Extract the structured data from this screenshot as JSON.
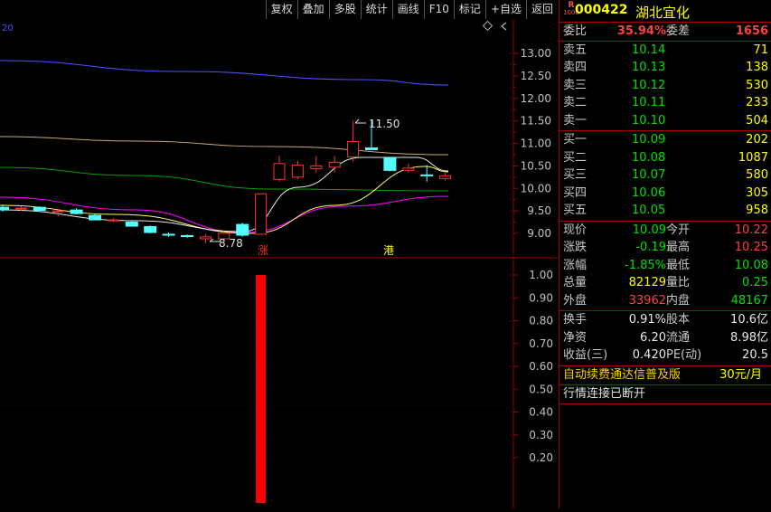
{
  "toolbar": {
    "buttons": [
      "复权",
      "叠加",
      "多股",
      "统计",
      "画线",
      "F10",
      "标记",
      "+自选",
      "返回"
    ]
  },
  "corner_label": "20",
  "chart_data": [
    {
      "type": "candlestick",
      "y_ticks": [
        "13.00",
        "12.50",
        "12.00",
        "11.50",
        "11.00",
        "10.50",
        "10.00",
        "9.50",
        "9.00"
      ],
      "ylim": [
        8.6,
        13.3
      ],
      "candles": [
        {
          "o": 9.58,
          "h": 9.64,
          "l": 9.48,
          "c": 9.52
        },
        {
          "o": 9.55,
          "h": 9.6,
          "l": 9.5,
          "c": 9.56
        },
        {
          "o": 9.58,
          "h": 9.6,
          "l": 9.5,
          "c": 9.51
        },
        {
          "o": 9.48,
          "h": 9.55,
          "l": 9.38,
          "c": 9.5
        },
        {
          "o": 9.52,
          "h": 9.56,
          "l": 9.42,
          "c": 9.44
        },
        {
          "o": 9.4,
          "h": 9.44,
          "l": 9.3,
          "c": 9.3
        },
        {
          "o": 9.3,
          "h": 9.34,
          "l": 9.25,
          "c": 9.3
        },
        {
          "o": 9.25,
          "h": 9.28,
          "l": 9.15,
          "c": 9.16
        },
        {
          "o": 9.15,
          "h": 9.18,
          "l": 9.0,
          "c": 9.02
        },
        {
          "o": 8.98,
          "h": 9.02,
          "l": 8.92,
          "c": 8.96
        },
        {
          "o": 8.95,
          "h": 8.98,
          "l": 8.9,
          "c": 8.94
        },
        {
          "o": 8.88,
          "h": 8.98,
          "l": 8.78,
          "c": 8.92
        },
        {
          "o": 8.88,
          "h": 9.05,
          "l": 8.84,
          "c": 9.0
        },
        {
          "o": 9.2,
          "h": 9.24,
          "l": 8.92,
          "c": 8.96
        },
        {
          "o": 8.98,
          "h": 9.88,
          "l": 8.97,
          "c": 9.88
        },
        {
          "o": 10.2,
          "h": 10.72,
          "l": 10.15,
          "c": 10.55
        },
        {
          "o": 10.25,
          "h": 10.62,
          "l": 10.2,
          "c": 10.52
        },
        {
          "o": 10.44,
          "h": 10.72,
          "l": 10.35,
          "c": 10.5
        },
        {
          "o": 10.47,
          "h": 10.72,
          "l": 10.36,
          "c": 10.58
        },
        {
          "o": 10.7,
          "h": 11.5,
          "l": 10.6,
          "c": 11.04
        },
        {
          "o": 10.9,
          "h": 11.5,
          "l": 10.85,
          "c": 10.86
        },
        {
          "o": 10.68,
          "h": 10.7,
          "l": 10.38,
          "c": 10.4
        },
        {
          "o": 10.4,
          "h": 10.55,
          "l": 10.35,
          "c": 10.45
        },
        {
          "o": 10.3,
          "h": 10.52,
          "l": 10.15,
          "c": 10.28
        },
        {
          "o": 10.22,
          "h": 10.35,
          "l": 10.18,
          "c": 10.28
        }
      ],
      "max_annotation": "11.50",
      "min_annotation": "8.78",
      "markers": [
        "涨",
        "港"
      ],
      "colors": {
        "up": "#ff3232",
        "down": "#54ffff",
        "ma_white": "#e8e8e8",
        "ma_yellow": "#ffff66",
        "ma_magenta": "#ff00ff",
        "ma_green": "#00a000",
        "ma_blue": "#5050ff",
        "ma_tan": "#c8a878"
      }
    },
    {
      "type": "bar",
      "y_ticks": [
        "1.00",
        "0.90",
        "0.80",
        "0.70",
        "0.60",
        "0.50",
        "0.40",
        "0.30",
        "0.20"
      ],
      "ylim": [
        0,
        1.05
      ],
      "bars": [
        {
          "index": 14,
          "value": 1.0,
          "color": "#ff0000"
        }
      ]
    }
  ],
  "quote": {
    "header": {
      "mark_top": "R",
      "mark_bottom": "1000",
      "code": "000422",
      "name": "湖北宜化"
    },
    "weibi": {
      "label": "委比",
      "value": "35.94%",
      "label2": "委差",
      "value2": "1656"
    },
    "asks": [
      {
        "label": "卖五",
        "price": "10.14",
        "vol": "71"
      },
      {
        "label": "卖四",
        "price": "10.13",
        "vol": "138"
      },
      {
        "label": "卖三",
        "price": "10.12",
        "vol": "530"
      },
      {
        "label": "卖二",
        "price": "10.11",
        "vol": "233"
      },
      {
        "label": "卖一",
        "price": "10.10",
        "vol": "504"
      }
    ],
    "bids": [
      {
        "label": "买一",
        "price": "10.09",
        "vol": "202"
      },
      {
        "label": "买二",
        "price": "10.08",
        "vol": "1087"
      },
      {
        "label": "买三",
        "price": "10.07",
        "vol": "580"
      },
      {
        "label": "买四",
        "price": "10.06",
        "vol": "305"
      },
      {
        "label": "买五",
        "price": "10.05",
        "vol": "958"
      }
    ],
    "stats": [
      {
        "l1": "现价",
        "v1": "10.09",
        "c1": "g",
        "l2": "今开",
        "v2": "10.22",
        "c2": "r"
      },
      {
        "l1": "涨跌",
        "v1": "-0.19",
        "c1": "g",
        "l2": "最高",
        "v2": "10.25",
        "c2": "r"
      },
      {
        "l1": "涨幅",
        "v1": "-1.85%",
        "c1": "g",
        "l2": "最低",
        "v2": "10.08",
        "c2": "g"
      },
      {
        "l1": "总量",
        "v1": "82129",
        "c1": "y",
        "l2": "量比",
        "v2": "0.25",
        "c2": "g"
      },
      {
        "l1": "外盘",
        "v1": "33962",
        "c1": "r",
        "l2": "内盘",
        "v2": "48167",
        "c2": "g"
      }
    ],
    "fundamentals": [
      {
        "l1": "换手",
        "v1": "0.91%",
        "l2": "股本",
        "v2": "10.6亿"
      },
      {
        "l1": "净资",
        "v1": "6.20",
        "l2": "流通",
        "v2": "8.98亿"
      },
      {
        "l1": "收益(三)",
        "v1": "0.420",
        "l2": "PE(动)",
        "v2": "20.5"
      }
    ],
    "ad": {
      "text": "自动续费通达信普及版",
      "price": "30元/月"
    },
    "status": "行情连接已断开"
  }
}
